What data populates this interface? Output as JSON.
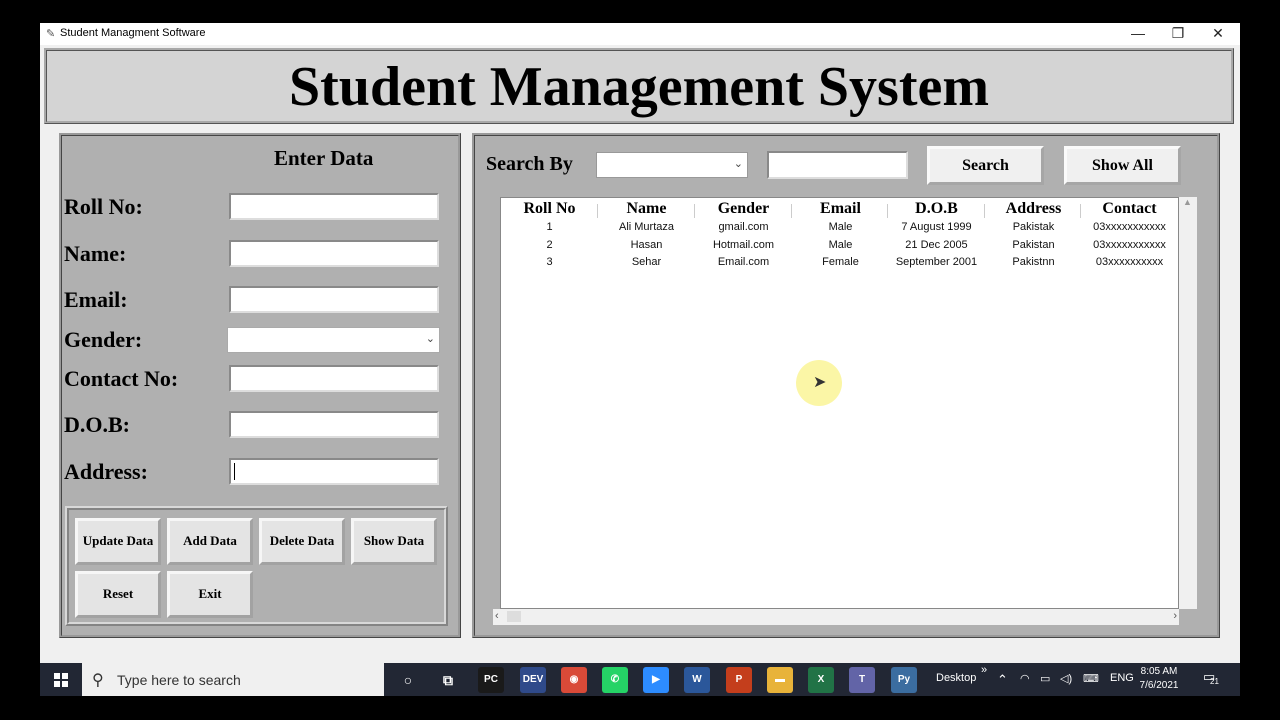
{
  "window": {
    "title": "Student Managment Software",
    "minimize": "—",
    "restore": "❐",
    "close": "✕"
  },
  "banner": {
    "title": "Student Management System"
  },
  "left_panel": {
    "title": "Enter Data",
    "labels": {
      "roll": "Roll No:",
      "name": "Name:",
      "email": "Email:",
      "gender": "Gender:",
      "contact": "Contact No:",
      "dob": "D.O.B:",
      "address": "Address:"
    },
    "values": {
      "roll": "",
      "name": "",
      "email": "",
      "gender": "",
      "contact": "",
      "dob": "",
      "address": ""
    },
    "buttons": {
      "update": "Update Data",
      "add": "Add Data",
      "delete": "Delete Data",
      "show": "Show Data",
      "reset": "Reset",
      "exit": "Exit"
    }
  },
  "right_panel": {
    "search_label": "Search By",
    "search_by_value": "",
    "search_text": "",
    "search_button": "Search",
    "show_all_button": "Show All",
    "table": {
      "columns": [
        "Roll No",
        "Name",
        "Gender",
        "Email",
        "D.O.B",
        "Address",
        "Contact"
      ],
      "rows": [
        [
          "1",
          "Ali Murtaza",
          "gmail.com",
          "Male",
          "7 August 1999",
          "Pakistak",
          "03xxxxxxxxxxx"
        ],
        [
          "2",
          "Hasan",
          "Hotmail.com",
          "Male",
          "21 Dec 2005",
          "Pakistan",
          "03xxxxxxxxxxx"
        ],
        [
          "3",
          "Sehar",
          "Email.com",
          "Female",
          "September 2001",
          "Pakistnn",
          "03xxxxxxxxxx"
        ]
      ]
    }
  },
  "taskbar": {
    "search_placeholder": "Type here to search",
    "desktop_label": "Desktop",
    "more": "»",
    "language": "ENG",
    "time": "8:05 AM",
    "date": "7/6/2021",
    "notifications": "21",
    "apps": [
      {
        "name": "pycharm-icon",
        "label": "PC",
        "color": "#1a1a1a"
      },
      {
        "name": "devcpp-icon",
        "label": "DEV",
        "color": "#2f4a8a"
      },
      {
        "name": "chrome-icon",
        "label": "◉",
        "color": "#d94a38"
      },
      {
        "name": "whatsapp-icon",
        "label": "✆",
        "color": "#25d366"
      },
      {
        "name": "zoom-icon",
        "label": "▶",
        "color": "#2d8cff"
      },
      {
        "name": "word-icon",
        "label": "W",
        "color": "#2b579a"
      },
      {
        "name": "powerpoint-icon",
        "label": "P",
        "color": "#c43e1c"
      },
      {
        "name": "file-explorer-icon",
        "label": "▬",
        "color": "#e8b33a"
      },
      {
        "name": "excel-icon",
        "label": "X",
        "color": "#217346"
      },
      {
        "name": "teams-icon",
        "label": "T",
        "color": "#6264a7"
      },
      {
        "name": "python-icon",
        "label": "Py",
        "color": "#3b6da0"
      }
    ]
  }
}
